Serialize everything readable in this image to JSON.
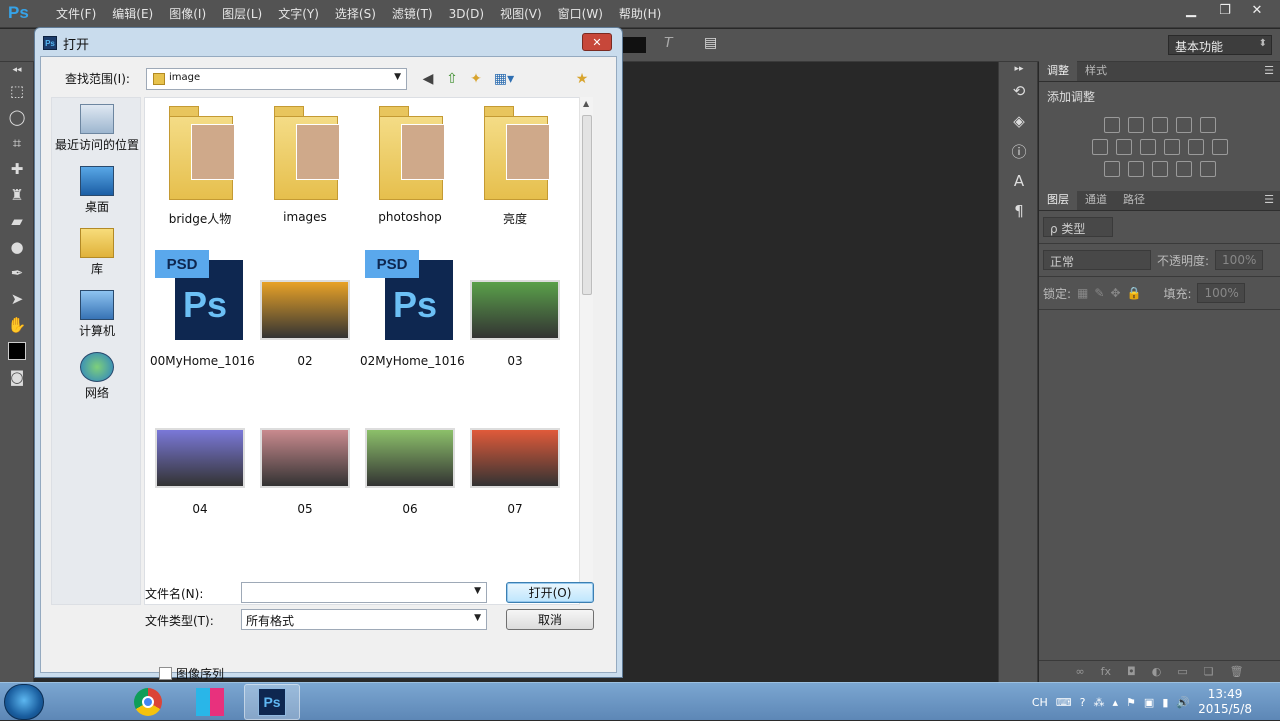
{
  "app": {
    "logo": "Ps"
  },
  "menu": {
    "items": [
      "文件(F)",
      "编辑(E)",
      "图像(I)",
      "图层(L)",
      "文字(Y)",
      "选择(S)",
      "滤镜(T)",
      "3D(D)",
      "视图(V)",
      "窗口(W)",
      "帮助(H)"
    ]
  },
  "options": {
    "workspace": "基本功能"
  },
  "panels": {
    "top_tabs": [
      "调整",
      "样式"
    ],
    "adjust_title": "添加调整",
    "layer_tabs": [
      "图层",
      "通道",
      "路径"
    ],
    "kind_filter": "ρ 类型",
    "blend_mode": "正常",
    "opacity_label": "不透明度:",
    "opacity_value": "100%",
    "lock_label": "锁定:",
    "fill_label": "填充:",
    "fill_value": "100%",
    "footer_fx": "fx"
  },
  "dialog": {
    "title": "打开",
    "close": "✕",
    "look_in_label": "查找范围(I):",
    "look_in_value": "image",
    "places": [
      "最近访问的位置",
      "桌面",
      "库",
      "计算机",
      "网络"
    ],
    "files": [
      {
        "name": "bridge人物",
        "kind": "folder"
      },
      {
        "name": "images",
        "kind": "folder"
      },
      {
        "name": "photoshop",
        "kind": "folder"
      },
      {
        "name": "亮度",
        "kind": "folder"
      },
      {
        "name": "00MyHome_1016",
        "kind": "psd"
      },
      {
        "name": "02",
        "kind": "photo",
        "color": "#e8a227"
      },
      {
        "name": "02MyHome_1016",
        "kind": "psd"
      },
      {
        "name": "03",
        "kind": "photo",
        "color": "#5aa04a"
      },
      {
        "name": "04",
        "kind": "photo",
        "color": "#7a78d8"
      },
      {
        "name": "05",
        "kind": "photo",
        "color": "#c98a8e"
      },
      {
        "name": "06",
        "kind": "photo",
        "color": "#8cc06a"
      },
      {
        "name": "07",
        "kind": "photo",
        "color": "#e05a3a"
      }
    ],
    "psd_tab": "PSD",
    "psd_mark": "Ps",
    "filename_label": "文件名(N):",
    "filename_value": "",
    "filetype_label": "文件类型(T):",
    "filetype_value": "所有格式",
    "open_button": "打开(O)",
    "cancel_button": "取消",
    "image_sequence": "图像序列"
  },
  "taskbar": {
    "ime": "CH",
    "time": "13:49",
    "date": "2015/5/8",
    "ps_label": "Ps"
  }
}
